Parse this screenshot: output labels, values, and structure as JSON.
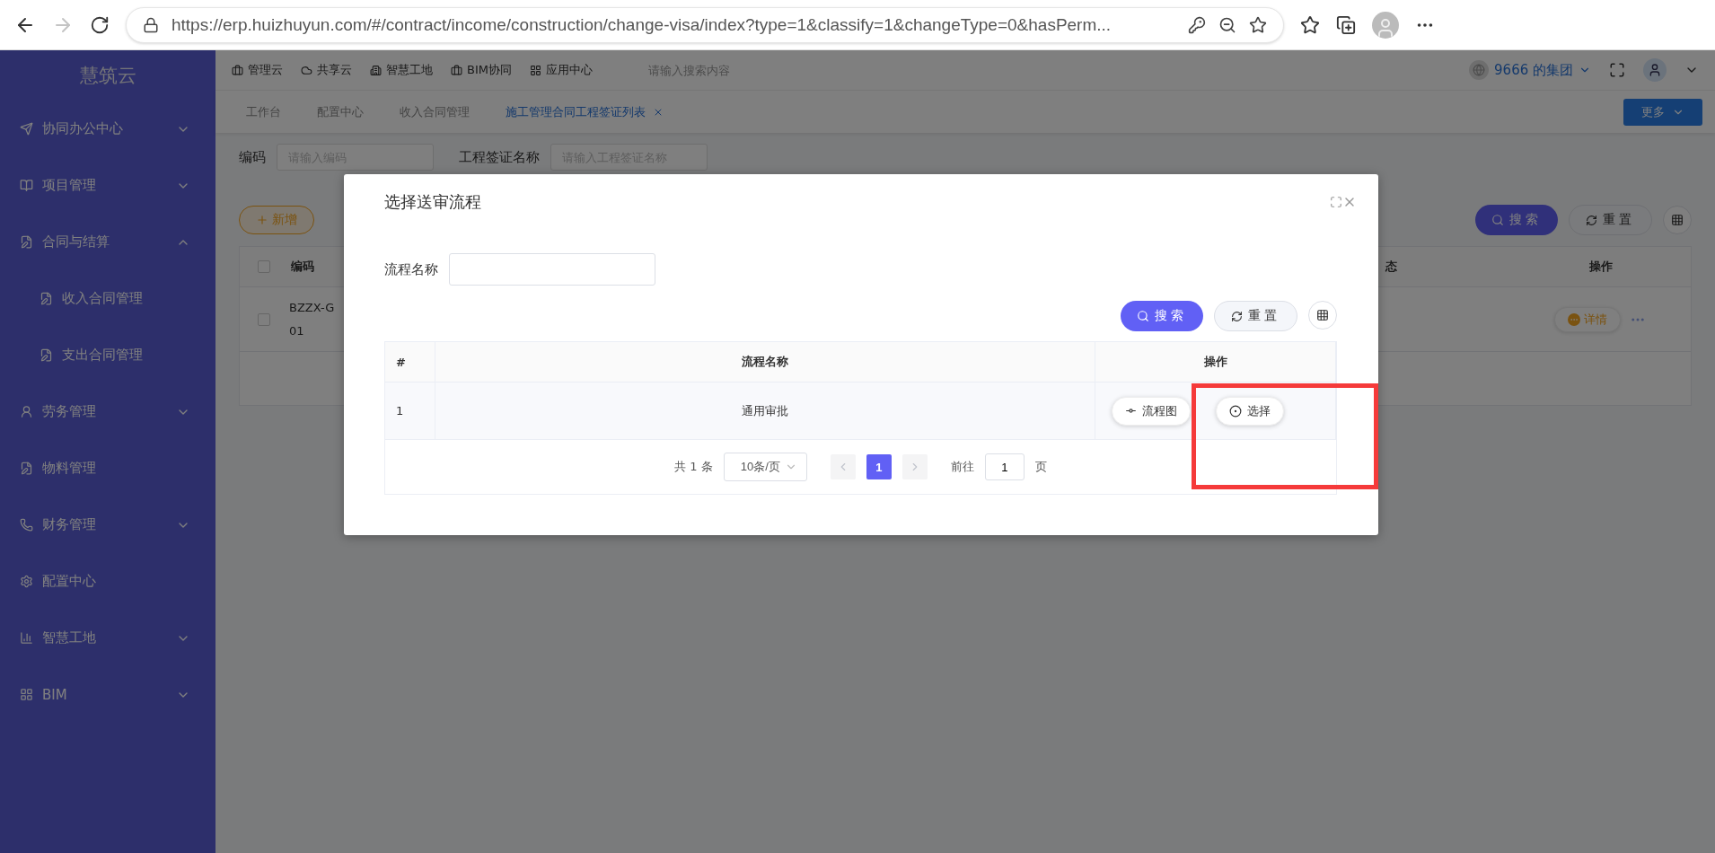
{
  "browser": {
    "url": "https://erp.huizhuyun.com/#/contract/income/construction/change-visa/index?type=1&classify=1&changeType=0&hasPerm..."
  },
  "sidebar": {
    "logo": "慧筑云",
    "items": [
      {
        "label": "协同办公中心",
        "kind": "group",
        "expanded": false
      },
      {
        "label": "项目管理",
        "kind": "group",
        "expanded": false
      },
      {
        "label": "合同与结算",
        "kind": "group",
        "expanded": true,
        "children": [
          {
            "label": "收入合同管理"
          },
          {
            "label": "支出合同管理"
          }
        ]
      },
      {
        "label": "劳务管理",
        "kind": "group",
        "expanded": false
      },
      {
        "label": "物料管理",
        "kind": "link"
      },
      {
        "label": "财务管理",
        "kind": "group",
        "expanded": false
      },
      {
        "label": "配置中心",
        "kind": "link"
      },
      {
        "label": "智慧工地",
        "kind": "group",
        "expanded": false
      },
      {
        "label": "BIM",
        "kind": "group",
        "expanded": false
      }
    ]
  },
  "header": {
    "nav": [
      "管理云",
      "共享云",
      "智慧工地",
      "BIM协同",
      "应用中心"
    ],
    "search": {
      "placeholder": "请输入搜索内容"
    },
    "org": "9666 的集团"
  },
  "tabs": [
    {
      "label": "工作台",
      "selected": false,
      "closable": false
    },
    {
      "label": "配置中心",
      "selected": false,
      "closable": false
    },
    {
      "label": "收入合同管理",
      "selected": false,
      "closable": false
    },
    {
      "label": "施工管理合同工程签证列表",
      "selected": true,
      "closable": true
    }
  ],
  "more_button": "更多",
  "filters": [
    {
      "label": "编码",
      "placeholder": "请输入编码"
    },
    {
      "label": "工程签证名称",
      "placeholder": "请输入工程签证名称"
    }
  ],
  "toolbar": {
    "add": "新增",
    "search": "搜索",
    "reset": "重置"
  },
  "table": {
    "header_checked": false,
    "columns": [
      "编码",
      "态",
      "操作"
    ],
    "rows": [
      {
        "checked": false,
        "code_lines": [
          "BZZX-G",
          "01"
        ],
        "action": "详情"
      }
    ]
  },
  "dialog": {
    "title": "选择送审流程",
    "field": {
      "label": "流程名称"
    },
    "search": "搜索",
    "reset": "重置",
    "columns": [
      "#",
      "流程名称",
      "操作"
    ],
    "rows": [
      {
        "index": "1",
        "name": "通用审批",
        "actions": [
          "流程图",
          "选择"
        ]
      }
    ],
    "pagination": {
      "total": "共 1 条",
      "page_size": "10条/页",
      "pages": [
        {
          "label": "1",
          "selected": true
        }
      ],
      "jump_label": "前往",
      "jump_value": "1",
      "jump_suffix": "页"
    }
  }
}
